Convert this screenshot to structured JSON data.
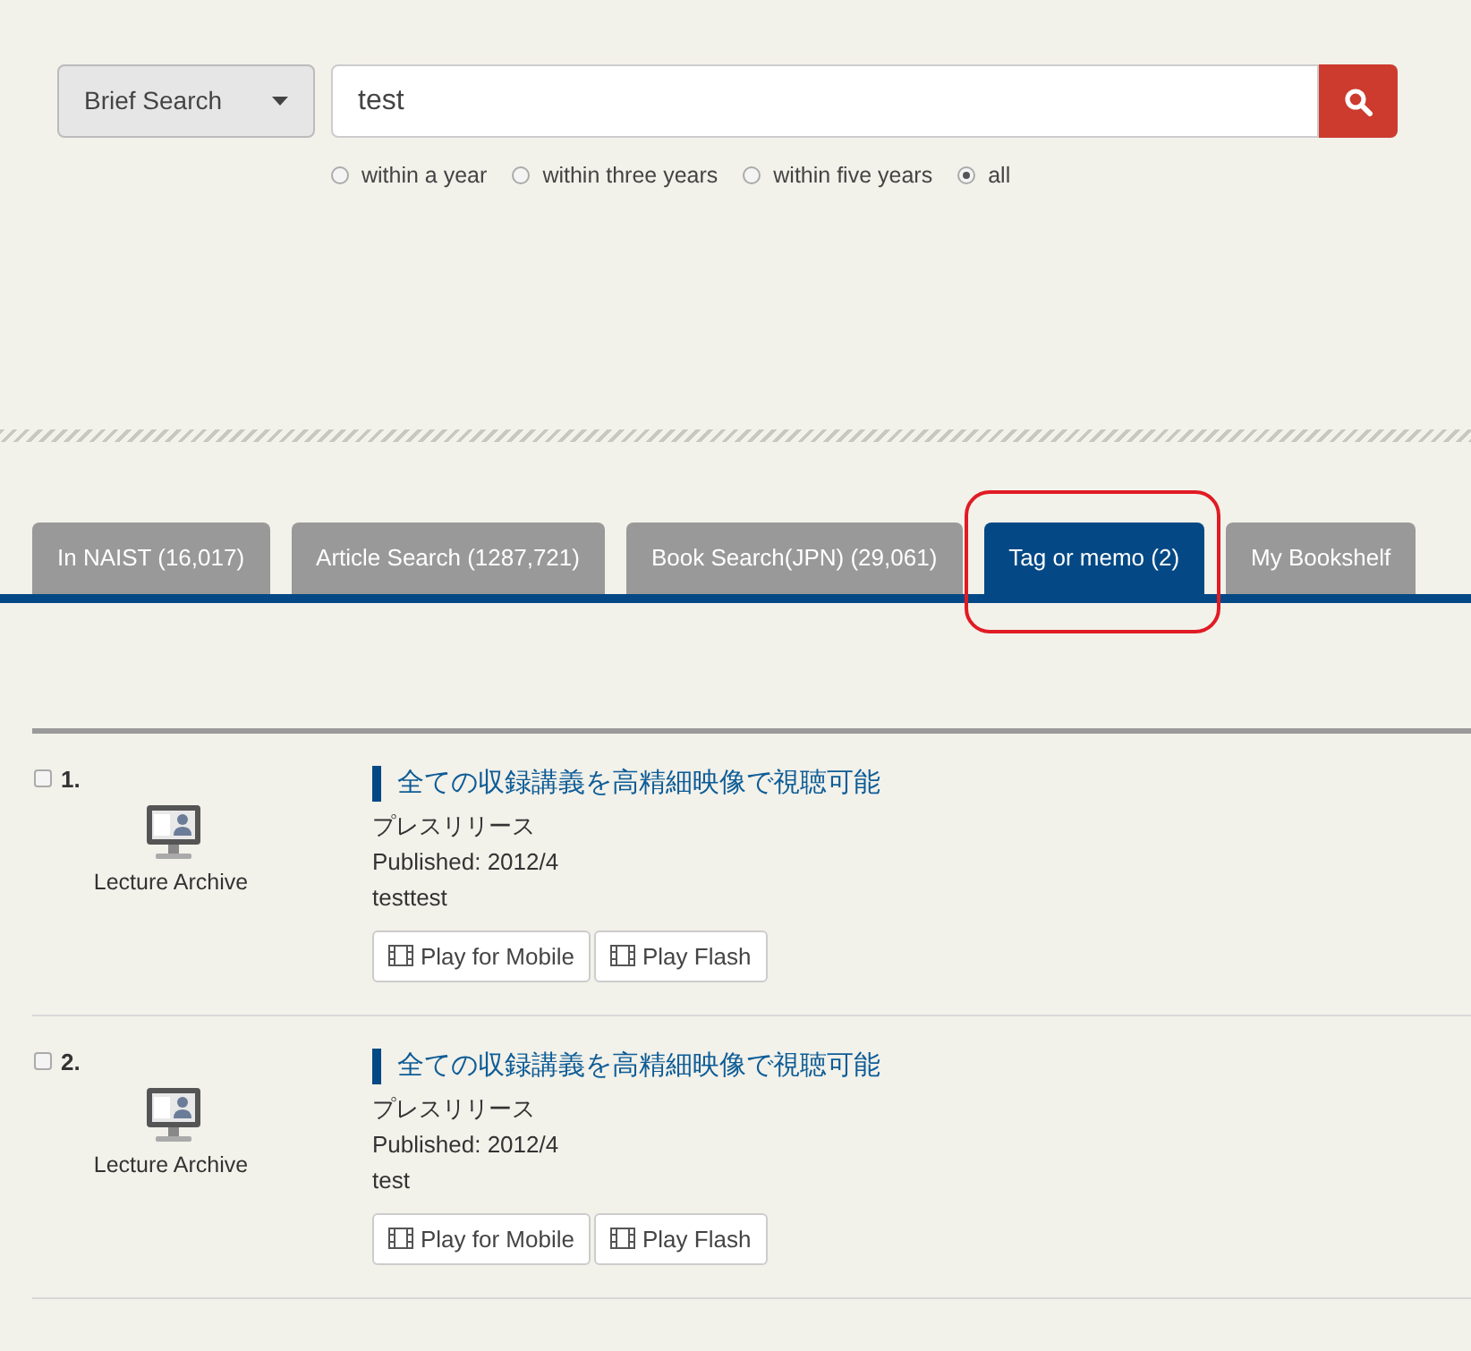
{
  "search": {
    "mode": "Brief Search",
    "query": "test"
  },
  "periods": [
    {
      "label": "within a year",
      "selected": false
    },
    {
      "label": "within three years",
      "selected": false
    },
    {
      "label": "within five years",
      "selected": false
    },
    {
      "label": "all",
      "selected": true
    }
  ],
  "tabs": [
    {
      "label": "In NAIST (16,017)",
      "selected": false,
      "highlighted": false
    },
    {
      "label": "Article Search (1287,721)",
      "selected": false,
      "highlighted": false
    },
    {
      "label": "Book Search(JPN) (29,061)",
      "selected": false,
      "highlighted": false
    },
    {
      "label": "Tag or memo (2)",
      "selected": true,
      "highlighted": true
    },
    {
      "label": "My Bookshelf",
      "selected": false,
      "highlighted": false
    }
  ],
  "results": [
    {
      "number": "1.",
      "checked": false,
      "type": "Lecture Archive",
      "title": "全ての収録講義を高精細映像で視聴可能",
      "source": "プレスリリース",
      "published": "Published: 2012/4",
      "memo": "testtest",
      "buttons": [
        "Play for Mobile",
        "Play Flash"
      ]
    },
    {
      "number": "2.",
      "checked": false,
      "type": "Lecture Archive",
      "title": "全ての収録講義を高精細映像で視聴可能",
      "source": "プレスリリース",
      "published": "Published: 2012/4",
      "memo": "test",
      "buttons": [
        "Play for Mobile",
        "Play Flash"
      ]
    }
  ]
}
